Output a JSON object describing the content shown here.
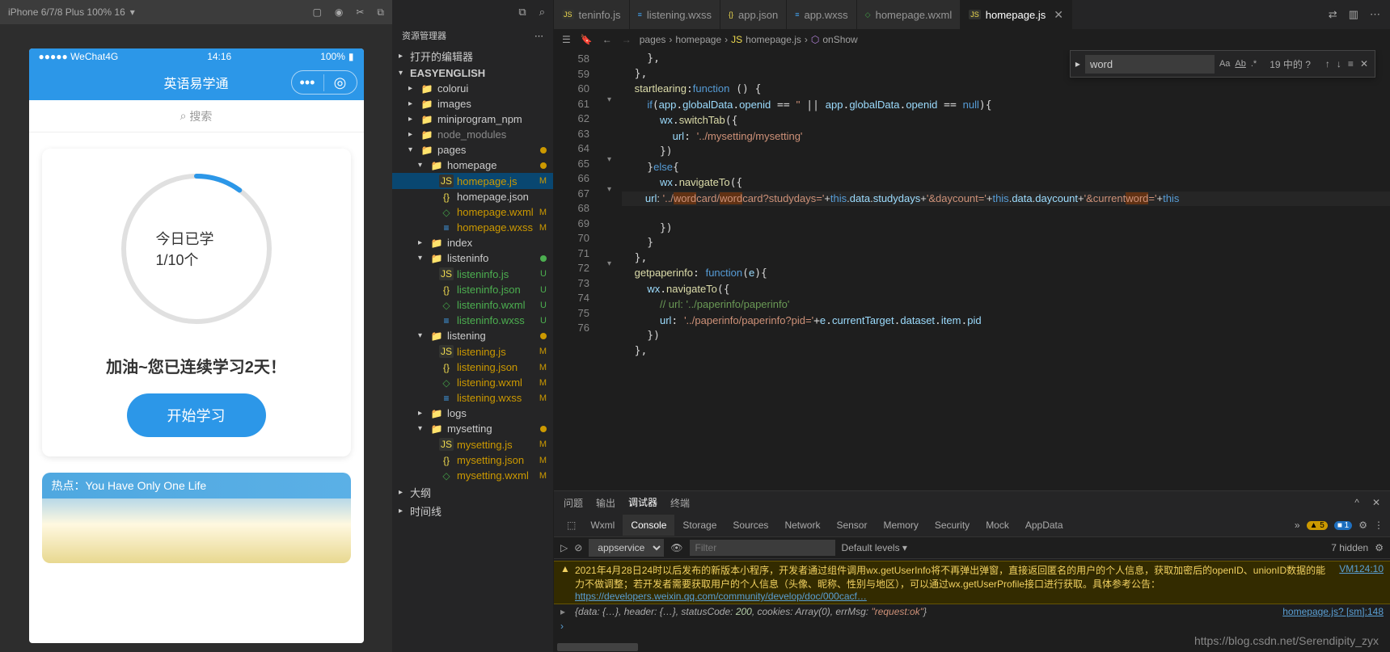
{
  "sim": {
    "device": "iPhone 6/7/8 Plus 100% 16",
    "status_left": "●●●●● WeChat4G",
    "time": "14:16",
    "battery": "100%",
    "app_title": "英语易学通",
    "search_placeholder": "搜索",
    "progress_text": "今日已学1/10个",
    "encourage": "加油~您已连续学习2天！",
    "start_button": "开始学习",
    "hot_label": "热点：",
    "hot_title": "You Have Only One Life"
  },
  "explorer": {
    "header": "资源管理器",
    "sections": {
      "open_editors": "打开的编辑器",
      "project": "EASYENGLISH",
      "outline": "大纲",
      "timeline": "时间线"
    },
    "tree": [
      {
        "label": "colorui",
        "type": "folder",
        "indent": 1
      },
      {
        "label": "images",
        "type": "folder",
        "indent": 1
      },
      {
        "label": "miniprogram_npm",
        "type": "folder",
        "indent": 1
      },
      {
        "label": "node_modules",
        "type": "folder",
        "indent": 1,
        "dim": true
      },
      {
        "label": "pages",
        "type": "folder",
        "indent": 1,
        "open": true,
        "dot": "#cc9900"
      },
      {
        "label": "homepage",
        "type": "folder",
        "indent": 2,
        "open": true,
        "dot": "#cc9900"
      },
      {
        "label": "homepage.js",
        "type": "js",
        "indent": 3,
        "badge": "M",
        "selected": true
      },
      {
        "label": "homepage.json",
        "type": "json",
        "indent": 3
      },
      {
        "label": "homepage.wxml",
        "type": "wxml",
        "indent": 3,
        "badge": "M"
      },
      {
        "label": "homepage.wxss",
        "type": "wxss",
        "indent": 3,
        "badge": "M"
      },
      {
        "label": "index",
        "type": "folder",
        "indent": 2
      },
      {
        "label": "listeninfo",
        "type": "folder",
        "indent": 2,
        "open": true,
        "dot": "#4caf50"
      },
      {
        "label": "listeninfo.js",
        "type": "js",
        "indent": 3,
        "badge": "U"
      },
      {
        "label": "listeninfo.json",
        "type": "json",
        "indent": 3,
        "badge": "U"
      },
      {
        "label": "listeninfo.wxml",
        "type": "wxml",
        "indent": 3,
        "badge": "U"
      },
      {
        "label": "listeninfo.wxss",
        "type": "wxss",
        "indent": 3,
        "badge": "U"
      },
      {
        "label": "listening",
        "type": "folder",
        "indent": 2,
        "open": true,
        "dot": "#cc9900"
      },
      {
        "label": "listening.js",
        "type": "js",
        "indent": 3,
        "badge": "M"
      },
      {
        "label": "listening.json",
        "type": "json",
        "indent": 3,
        "badge": "M"
      },
      {
        "label": "listening.wxml",
        "type": "wxml",
        "indent": 3,
        "badge": "M"
      },
      {
        "label": "listening.wxss",
        "type": "wxss",
        "indent": 3,
        "badge": "M"
      },
      {
        "label": "logs",
        "type": "folder",
        "indent": 2
      },
      {
        "label": "mysetting",
        "type": "folder",
        "indent": 2,
        "open": true,
        "dot": "#cc9900"
      },
      {
        "label": "mysetting.js",
        "type": "js",
        "indent": 3,
        "badge": "M"
      },
      {
        "label": "mysetting.json",
        "type": "json",
        "indent": 3,
        "badge": "M"
      },
      {
        "label": "mysetting.wxml",
        "type": "wxml",
        "indent": 3,
        "badge": "M"
      }
    ]
  },
  "tabs": [
    {
      "label": "teninfo.js",
      "icon": "js"
    },
    {
      "label": "listening.wxss",
      "icon": "wxss"
    },
    {
      "label": "app.json",
      "icon": "json"
    },
    {
      "label": "app.wxss",
      "icon": "wxss"
    },
    {
      "label": "homepage.wxml",
      "icon": "wxml"
    },
    {
      "label": "homepage.js",
      "icon": "js",
      "active": true
    }
  ],
  "breadcrumb": [
    "pages",
    "homepage",
    "homepage.js",
    "onShow"
  ],
  "find": {
    "value": "word",
    "result": "19 中的 ?"
  },
  "line_numbers": [
    58,
    59,
    60,
    61,
    62,
    63,
    64,
    65,
    66,
    67,
    68,
    69,
    70,
    71,
    72,
    73,
    74,
    75,
    76
  ],
  "panel": {
    "tabs": [
      "问题",
      "输出",
      "调试器",
      "终端"
    ],
    "active_tab": "调试器",
    "devtools": [
      "Wxml",
      "Console",
      "Storage",
      "Sources",
      "Network",
      "Sensor",
      "Memory",
      "Security",
      "Mock",
      "AppData"
    ],
    "devtools_active": "Console",
    "warn_count": "5",
    "info_count": "1",
    "context": "appservice",
    "filter_placeholder": "Filter",
    "levels": "Default levels",
    "hidden": "7 hidden"
  },
  "console": {
    "warn_msg": "2021年4月28日24时以后发布的新版本小程序，开发者通过组件调用wx.getUserInfo将不再弹出弹窗，直接返回匿名的用户的个人信息，获取加密后的openID、unionID数据的能力不做调整；若开发者需要获取用户的个人信息（头像、昵称、性别与地区），可以通过wx.getUserProfile接口进行获取。具体参考公告：",
    "warn_link": "https://developers.weixin.qq.com/community/develop/doc/000cacf…",
    "warn_src": "VM124:10",
    "log_msg_pre": "{data: {…}, header: {…}, statusCode: ",
    "log_status": "200",
    "log_msg_mid": ", cookies: Array(0), errMsg: ",
    "log_msg_str": "\"request:ok\"",
    "log_msg_end": "}",
    "log_src": "homepage.js? [sm]:148"
  },
  "watermark": "https://blog.csdn.net/Serendipity_zyx"
}
